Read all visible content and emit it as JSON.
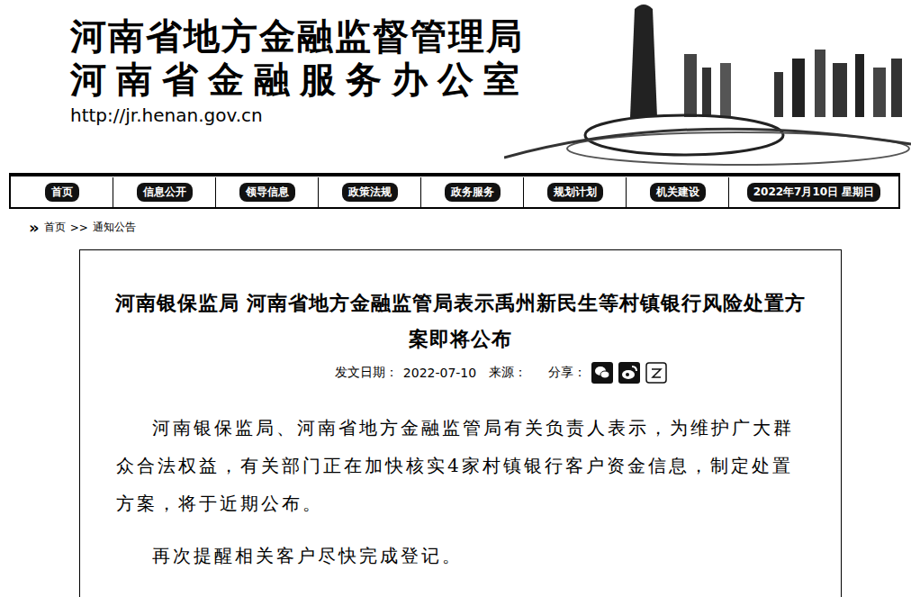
{
  "site": {
    "title": "河南省地方金融监督管理局",
    "subtitle": "河南省金融服务办公室",
    "url": "http://jr.henan.gov.cn"
  },
  "nav": {
    "items": [
      {
        "label": "首页",
        "selected": false
      },
      {
        "label": "信息公开",
        "selected": false
      },
      {
        "label": "领导信息",
        "selected": false
      },
      {
        "label": "政策法规",
        "selected": false
      },
      {
        "label": "政务服务",
        "selected": false
      },
      {
        "label": "规划计划",
        "selected": false
      },
      {
        "label": "机关建设",
        "selected": false
      }
    ],
    "date": "2022年7月10日 星期日"
  },
  "breadcrumb": {
    "icon": "»",
    "items": [
      "首页",
      "通知公告"
    ],
    "separator": ">>"
  },
  "article": {
    "title": "河南银保监局 河南省地方金融监管局表示禹州新民生等村镇银行风险处置方案即将公布",
    "meta": {
      "date_label": "发文日期：",
      "date": "2022-07-10",
      "source_label": "来源：",
      "share_label": "分享："
    },
    "paragraphs": [
      "河南银保监局、河南省地方金融监管局有关负责人表示，为维护广大群众合法权益，有关部门正在加快核实4家村镇银行客户资金信息，制定处置方案，将于近期公布。",
      "再次提醒相关客户尽快完成登记。"
    ]
  }
}
